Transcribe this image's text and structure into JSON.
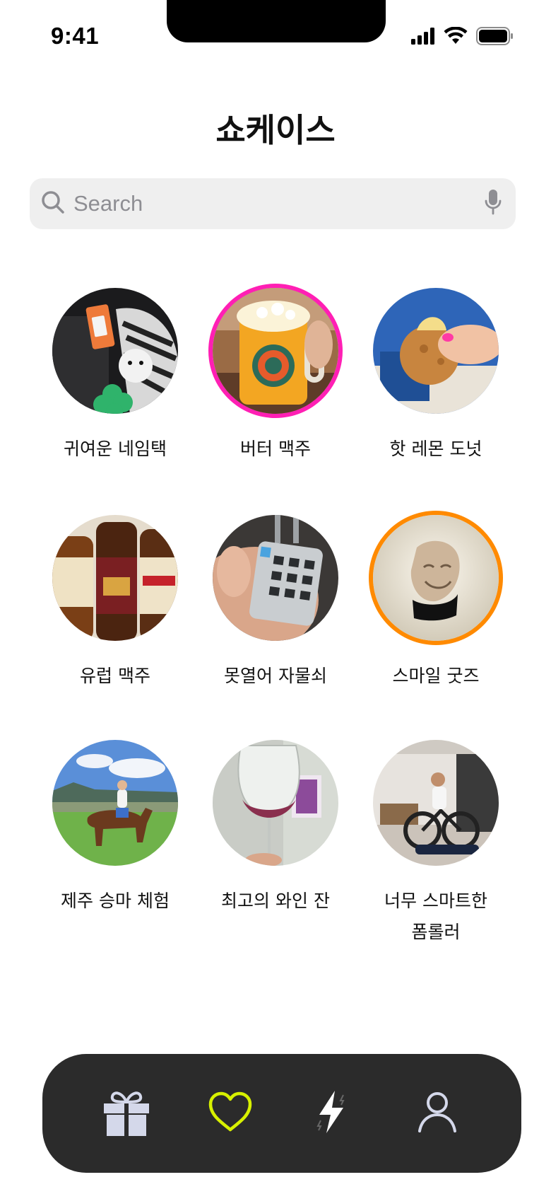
{
  "status_bar": {
    "time": "9:41",
    "icons": [
      "signal-icon",
      "wifi-icon",
      "battery-icon"
    ]
  },
  "header": {
    "title": "쇼케이스"
  },
  "search": {
    "placeholder": "Search",
    "value": "",
    "icons": [
      "search-icon",
      "microphone-icon"
    ]
  },
  "showcase": {
    "items": [
      {
        "label": "귀여운 네임택",
        "highlight": "none"
      },
      {
        "label": "버터 맥주",
        "highlight": "#ff1fb4"
      },
      {
        "label": "핫 레몬 도넛",
        "highlight": "none"
      },
      {
        "label": "유럽 맥주",
        "highlight": "none"
      },
      {
        "label": "못열어 자물쇠",
        "highlight": "none"
      },
      {
        "label": "스마일 굿즈",
        "highlight": "#ff8a00"
      },
      {
        "label": "제주 승마 체험",
        "highlight": "none"
      },
      {
        "label": "최고의 와인 잔",
        "highlight": "none"
      },
      {
        "label": "너무 스마트한\n폼롤러",
        "highlight": "none"
      }
    ]
  },
  "tab_bar": {
    "tabs": [
      {
        "icon": "gift-icon",
        "active": false
      },
      {
        "icon": "heart-icon",
        "active": true
      },
      {
        "icon": "lightning-icon",
        "active": false
      },
      {
        "icon": "profile-icon",
        "active": false
      }
    ],
    "active_color": "#d7f000",
    "inactive_color": "#d4d8ea"
  }
}
